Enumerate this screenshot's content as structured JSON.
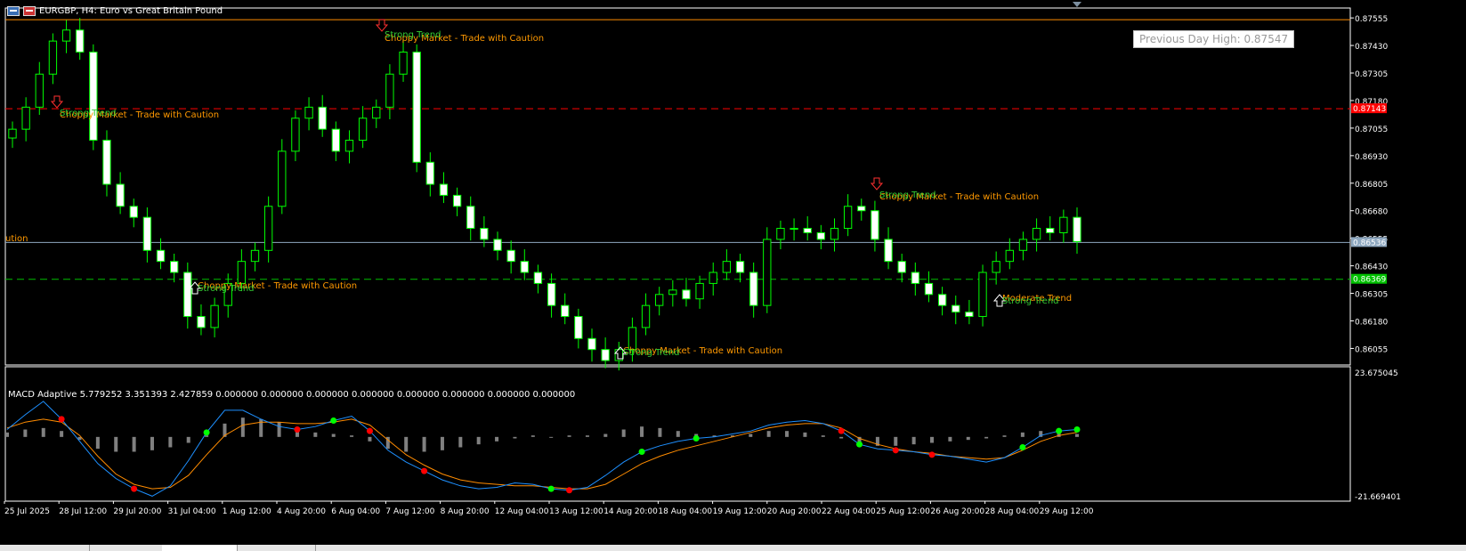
{
  "window": {
    "title": "EURGBP, H4:  Euro vs Great Britain Pound"
  },
  "badge": {
    "previous_day_high": "Previous Day High: 0.87547"
  },
  "macd": {
    "title": "MACD Adaptive 5.779252 3.351393 2.427859 0.000000 0.000000 0.000000 0.000000 0.000000 0.000000 0.000000 0.000000",
    "scale_max": "23.675045",
    "scale_min": "-21.669401"
  },
  "colors": {
    "background": "#000000",
    "candle": "#00ff00",
    "candle_bull_body": "#000000",
    "candle_bear_body": "#ffffff",
    "resistance_line": "#ff0000",
    "support_line": "#00c000",
    "price_line": "#8fa8c0",
    "top_line": "#ff8c00",
    "annotation_orange": "#ff9900",
    "annotation_green": "#33cc33",
    "macd_line": "#1e90ff",
    "signal_line": "#ff8c00",
    "histogram": "#808080",
    "dot_red": "#ff0000",
    "dot_green": "#00ff00",
    "axis_text": "#ffffff"
  },
  "chart_data": [
    {
      "type": "candlestick",
      "symbol": "EURGBP",
      "timeframe": "H4",
      "ylim": [
        0.8598,
        0.876
      ],
      "price_axis_ticks": [
        "0.87555",
        "0.87430",
        "0.87305",
        "0.87180",
        "0.87055",
        "0.86930",
        "0.86805",
        "0.86680",
        "0.86555",
        "0.86430",
        "0.86305",
        "0.86180",
        "0.86055"
      ],
      "time_axis_labels": [
        "25 Jul 2025",
        "28 Jul 12:00",
        "29 Jul 20:00",
        "31 Jul 04:00",
        "1 Aug 12:00",
        "4 Aug 20:00",
        "6 Aug 04:00",
        "7 Aug 12:00",
        "8 Aug 20:00",
        "12 Aug 04:00",
        "13 Aug 12:00",
        "14 Aug 20:00",
        "18 Aug 04:00",
        "19 Aug 12:00",
        "20 Aug 20:00",
        "22 Aug 04:00",
        "25 Aug 12:00",
        "26 Aug 20:00",
        "28 Aug 04:00",
        "29 Aug 12:00"
      ],
      "horizontal_lines": [
        {
          "name": "resistance",
          "value": 0.87143,
          "label": "0.87143",
          "style": "dashed",
          "color": "#ff0000"
        },
        {
          "name": "current-price",
          "value": 0.86536,
          "label": "0.86536",
          "style": "solid",
          "color": "#8fa8c0"
        },
        {
          "name": "support",
          "value": 0.86369,
          "label": "0.86369",
          "style": "dashed",
          "color": "#00c000"
        },
        {
          "name": "previous-day-high",
          "value": 0.87547,
          "label": "",
          "style": "solid",
          "color": "#ff8c00"
        }
      ],
      "close_series": [
        0.8705,
        0.8715,
        0.873,
        0.8745,
        0.875,
        0.874,
        0.87,
        0.868,
        0.867,
        0.8665,
        0.865,
        0.8645,
        0.864,
        0.862,
        0.8615,
        0.8625,
        0.8635,
        0.8645,
        0.865,
        0.867,
        0.8695,
        0.871,
        0.8715,
        0.8705,
        0.8695,
        0.87,
        0.871,
        0.8715,
        0.873,
        0.874,
        0.869,
        0.868,
        0.8675,
        0.867,
        0.866,
        0.8655,
        0.865,
        0.8645,
        0.864,
        0.8635,
        0.8625,
        0.862,
        0.861,
        0.8605,
        0.86,
        0.8605,
        0.8615,
        0.8625,
        0.863,
        0.8632,
        0.8628,
        0.8635,
        0.864,
        0.8645,
        0.864,
        0.8625,
        0.8655,
        0.866,
        0.866,
        0.8658,
        0.8655,
        0.866,
        0.867,
        0.8668,
        0.8655,
        0.8645,
        0.864,
        0.8635,
        0.863,
        0.8625,
        0.8622,
        0.862,
        0.864,
        0.8645,
        0.865,
        0.8655,
        0.866,
        0.8658,
        0.8665,
        0.8654
      ],
      "annotations": [
        {
          "text": "Choppy Market - Trade with Caution",
          "color": "#ff9900",
          "arrow": "down"
        },
        {
          "text": "Strong Trend",
          "color": "#33cc33",
          "arrow": "down"
        },
        {
          "text": "Choppy Market - Trade with Caution",
          "color": "#ff9900",
          "arrow": "down"
        },
        {
          "text": "Strong Trend",
          "color": "#33cc33",
          "arrow": "down"
        },
        {
          "text": "Choppy Market - Trade with Caution",
          "color": "#ff9900",
          "arrow": "up"
        },
        {
          "text": "Strong Trend",
          "color": "#33cc33",
          "arrow": "up"
        },
        {
          "text": "Choppy Market - Trade with Caution",
          "color": "#ff9900",
          "arrow": "up"
        },
        {
          "text": "Strong Trend",
          "color": "#33cc33",
          "arrow": "up"
        },
        {
          "text": "Choppy Market - Trade with Caution",
          "color": "#ff9900",
          "arrow": "down"
        },
        {
          "text": "Strong Trend",
          "color": "#33cc33",
          "arrow": "down"
        },
        {
          "text": "Moderate Trend",
          "color": "#ff9900",
          "arrow": "up"
        },
        {
          "text": "Strong Trend",
          "color": "#33cc33",
          "arrow": "up"
        },
        {
          "text": "ution",
          "color": "#ff9900",
          "arrow": "none"
        }
      ]
    },
    {
      "type": "macd",
      "title": "MACD Adaptive",
      "ylim": [
        -21.669401,
        23.675045
      ],
      "macd_line": [
        2.5,
        7.5,
        12.0,
        6.0,
        -1.5,
        -9.0,
        -14.0,
        -17.5,
        -20.0,
        -16.5,
        -8.0,
        1.5,
        9.0,
        9.0,
        6.0,
        3.5,
        2.5,
        3.5,
        5.5,
        7.0,
        2.0,
        -4.5,
        -8.5,
        -11.5,
        -14.5,
        -16.5,
        -17.5,
        -17.0,
        -15.5,
        -16.0,
        -17.5,
        -18.0,
        -17.0,
        -13.0,
        -8.5,
        -5.0,
        -3.0,
        -1.5,
        -0.5,
        0.0,
        1.0,
        2.0,
        4.0,
        5.0,
        5.5,
        4.5,
        2.0,
        -2.5,
        -4.0,
        -4.5,
        -5.0,
        -6.0,
        -6.5,
        -7.5,
        -8.5,
        -7.0,
        -3.5,
        0.5,
        2.0,
        2.5
      ],
      "signal_line": [
        3.0,
        5.0,
        6.0,
        5.0,
        0.5,
        -6.5,
        -12.5,
        -16.0,
        -17.5,
        -17.0,
        -13.0,
        -6.0,
        0.5,
        4.0,
        5.0,
        5.0,
        4.5,
        4.5,
        5.0,
        6.0,
        4.0,
        -1.0,
        -6.0,
        -9.5,
        -12.5,
        -14.5,
        -15.5,
        -16.0,
        -16.5,
        -16.5,
        -17.0,
        -17.5,
        -17.5,
        -16.0,
        -12.5,
        -9.0,
        -6.5,
        -4.5,
        -3.0,
        -1.5,
        0.0,
        1.5,
        3.0,
        4.0,
        4.5,
        4.5,
        3.0,
        -0.5,
        -2.5,
        -4.0,
        -5.0,
        -5.5,
        -6.5,
        -7.0,
        -7.5,
        -7.0,
        -4.5,
        -1.5,
        0.5,
        1.5
      ],
      "histogram": [
        1.5,
        2.5,
        3.0,
        2.0,
        -1.0,
        -4.0,
        -5.0,
        -5.0,
        -4.5,
        -3.5,
        -2.0,
        0.5,
        4.5,
        6.5,
        6.0,
        5.0,
        3.0,
        1.5,
        1.0,
        0.5,
        -1.5,
        -4.0,
        -5.0,
        -5.0,
        -4.5,
        -3.5,
        -2.5,
        -1.5,
        -0.5,
        0.5,
        0.0,
        0.5,
        0.5,
        1.0,
        2.5,
        3.5,
        3.0,
        2.0,
        1.0,
        0.5,
        0.5,
        1.0,
        2.0,
        2.0,
        1.5,
        0.5,
        -0.5,
        -2.0,
        -3.0,
        -3.0,
        -2.5,
        -2.0,
        -1.5,
        -1.0,
        -0.5,
        0.5,
        1.5,
        2.0,
        1.5,
        1.0
      ],
      "crossover_dots": [
        {
          "index": 3,
          "color": "red"
        },
        {
          "index": 7,
          "color": "red"
        },
        {
          "index": 11,
          "color": "green"
        },
        {
          "index": 16,
          "color": "red"
        },
        {
          "index": 18,
          "color": "green"
        },
        {
          "index": 20,
          "color": "red"
        },
        {
          "index": 23,
          "color": "red"
        },
        {
          "index": 30,
          "color": "green"
        },
        {
          "index": 31,
          "color": "red"
        },
        {
          "index": 35,
          "color": "green"
        },
        {
          "index": 38,
          "color": "green"
        },
        {
          "index": 46,
          "color": "red"
        },
        {
          "index": 47,
          "color": "green"
        },
        {
          "index": 49,
          "color": "red"
        },
        {
          "index": 51,
          "color": "red"
        },
        {
          "index": 56,
          "color": "green"
        },
        {
          "index": 58,
          "color": "green"
        },
        {
          "index": 59,
          "color": "green"
        }
      ]
    }
  ]
}
